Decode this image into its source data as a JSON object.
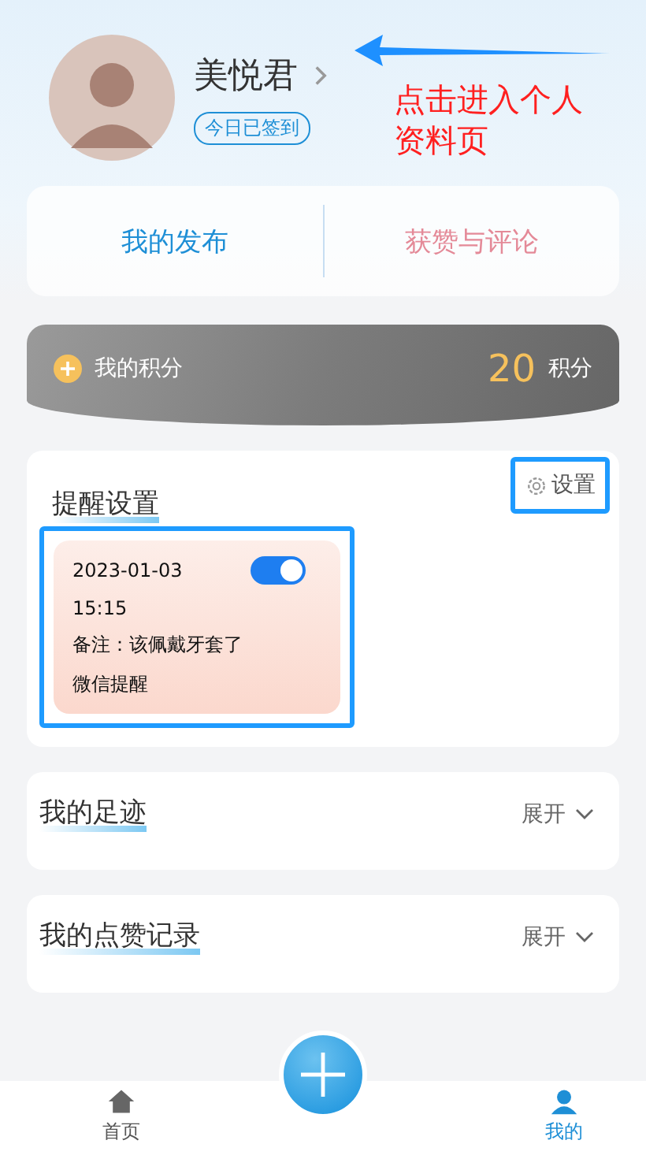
{
  "profile": {
    "name": "美悦君",
    "badge": "今日已签到"
  },
  "annotation": {
    "text": "点击进入个人资料页"
  },
  "tabs": [
    {
      "label": "我的发布",
      "color": "#1e8fd6"
    },
    {
      "label": "获赞与评论",
      "color": "#e48a98"
    }
  ],
  "points": {
    "label": "我的积分",
    "value": "20",
    "unit": "积分"
  },
  "reminders": {
    "title": "提醒设置",
    "settings_button": "设置",
    "items": [
      {
        "date": "2023-01-03",
        "time": "15:15",
        "note": "备注：该佩戴牙套了",
        "channel": "微信提醒",
        "on": true
      }
    ]
  },
  "sections": [
    {
      "title": "我的足迹",
      "action": "展开",
      "expanded": false
    },
    {
      "title": "我的点赞记录",
      "action": "展开",
      "expanded": false
    }
  ],
  "nav": [
    {
      "kind": "home",
      "label": "首页",
      "selected": false
    },
    {
      "kind": "profile",
      "label": "我的",
      "selected": true
    }
  ]
}
